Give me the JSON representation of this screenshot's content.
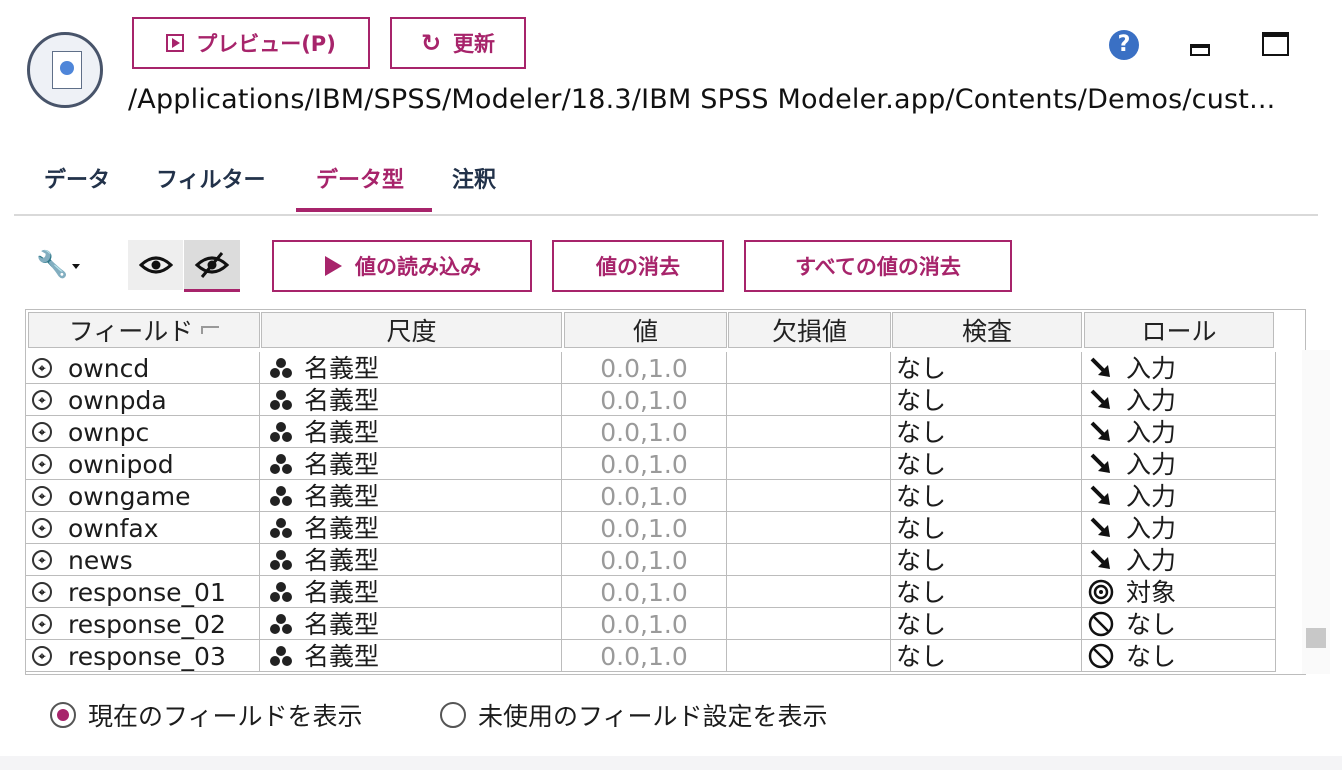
{
  "header": {
    "preview_label": "プレビュー(P)",
    "refresh_label": "更新",
    "refresh_glyph": "↻",
    "help_glyph": "?",
    "file_path": "/Applications/IBM/SPSS/Modeler/18.3/IBM SPSS Modeler.app/Contents/Demos/cust..."
  },
  "tabs": [
    {
      "label": "データ"
    },
    {
      "label": "フィルター"
    },
    {
      "label": "データ型",
      "active": true
    },
    {
      "label": "注釈"
    }
  ],
  "toolbar": {
    "read_values_label": "値の読み込み",
    "clear_values_label": "値の消去",
    "clear_all_values_label": "すべての値の消去"
  },
  "table": {
    "columns": [
      "フィールド",
      "尺度",
      "値",
      "欠損値",
      "検査",
      "ロール"
    ],
    "rows": [
      {
        "field": "owncd",
        "measurement": "名義型",
        "values": "0.0,1.0",
        "missing": "",
        "check": "なし",
        "role": "入力",
        "role_icon": "arrow-input-icon"
      },
      {
        "field": "ownpda",
        "measurement": "名義型",
        "values": "0.0,1.0",
        "missing": "",
        "check": "なし",
        "role": "入力",
        "role_icon": "arrow-input-icon"
      },
      {
        "field": "ownpc",
        "measurement": "名義型",
        "values": "0.0,1.0",
        "missing": "",
        "check": "なし",
        "role": "入力",
        "role_icon": "arrow-input-icon"
      },
      {
        "field": "ownipod",
        "measurement": "名義型",
        "values": "0.0,1.0",
        "missing": "",
        "check": "なし",
        "role": "入力",
        "role_icon": "arrow-input-icon"
      },
      {
        "field": "owngame",
        "measurement": "名義型",
        "values": "0.0,1.0",
        "missing": "",
        "check": "なし",
        "role": "入力",
        "role_icon": "arrow-input-icon"
      },
      {
        "field": "ownfax",
        "measurement": "名義型",
        "values": "0.0,1.0",
        "missing": "",
        "check": "なし",
        "role": "入力",
        "role_icon": "arrow-input-icon"
      },
      {
        "field": "news",
        "measurement": "名義型",
        "values": "0.0,1.0",
        "missing": "",
        "check": "なし",
        "role": "入力",
        "role_icon": "arrow-input-icon"
      },
      {
        "field": "response_01",
        "measurement": "名義型",
        "values": "0.0,1.0",
        "missing": "",
        "check": "なし",
        "role": "対象",
        "role_icon": "target-icon"
      },
      {
        "field": "response_02",
        "measurement": "名義型",
        "values": "0.0,1.0",
        "missing": "",
        "check": "なし",
        "role": "なし",
        "role_icon": "none-icon"
      },
      {
        "field": "response_03",
        "measurement": "名義型",
        "values": "0.0,1.0",
        "missing": "",
        "check": "なし",
        "role": "なし",
        "role_icon": "none-icon"
      }
    ]
  },
  "footer": {
    "show_current_label": "現在のフィールドを表示",
    "show_unused_label": "未使用のフィールド設定を表示",
    "selected": "show_current"
  },
  "colors": {
    "accent": "#a7246b",
    "help": "#3a70c4"
  }
}
